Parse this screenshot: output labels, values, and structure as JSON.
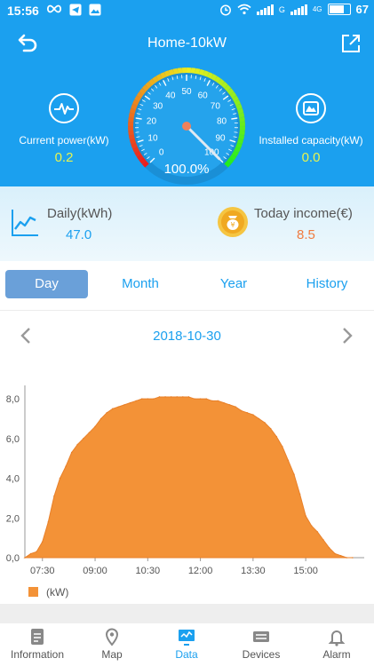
{
  "status": {
    "time": "15:56",
    "battery": "67",
    "sim": "G",
    "lte": "4G"
  },
  "header": {
    "title": "Home-10kW"
  },
  "current_power": {
    "label": "Current power(kW)",
    "value": "0.2"
  },
  "installed_capacity": {
    "label": "Installed capacity(kW)",
    "value": "0.0"
  },
  "gauge": {
    "percent_text": "100.0%",
    "ticks": [
      "0",
      "10",
      "20",
      "30",
      "40",
      "50",
      "60",
      "70",
      "80",
      "90",
      "100"
    ],
    "level": 1.0
  },
  "summary": {
    "daily_label": "Daily(kWh)",
    "daily_value": "47.0",
    "income_label": "Today income(€)",
    "income_value": "8.5"
  },
  "tabs": [
    "Day",
    "Month",
    "Year",
    "History"
  ],
  "active_tab": "Day",
  "date": "2018-10-30",
  "chart_data": {
    "type": "area",
    "x_ticks": [
      "07:30",
      "09:00",
      "10:30",
      "12:00",
      "13:30",
      "15:00"
    ],
    "y_ticks": [
      "0,0",
      "2,0",
      "4,0",
      "6,0",
      "8,0"
    ],
    "ylim": [
      0,
      8.5
    ],
    "xlim": [
      "07:00",
      "16:40"
    ],
    "legend": "(kW)",
    "x": [
      "07:00",
      "07:10",
      "07:20",
      "07:30",
      "07:40",
      "07:50",
      "08:00",
      "08:10",
      "08:20",
      "08:30",
      "08:40",
      "08:50",
      "09:00",
      "09:10",
      "09:20",
      "09:30",
      "09:40",
      "09:50",
      "10:00",
      "10:10",
      "10:20",
      "10:30",
      "10:40",
      "10:50",
      "11:00",
      "11:10",
      "11:20",
      "11:30",
      "11:40",
      "11:50",
      "12:00",
      "12:10",
      "12:20",
      "12:30",
      "12:40",
      "12:50",
      "13:00",
      "13:10",
      "13:20",
      "13:30",
      "13:40",
      "13:50",
      "14:00",
      "14:10",
      "14:20",
      "14:30",
      "14:40",
      "14:50",
      "15:00",
      "15:10",
      "15:20",
      "15:30",
      "15:40",
      "15:50",
      "16:00",
      "16:10",
      "16:20"
    ],
    "values": [
      0.0,
      0.2,
      0.3,
      0.8,
      1.8,
      3.1,
      4.0,
      4.6,
      5.3,
      5.7,
      6.0,
      6.3,
      6.6,
      7.0,
      7.3,
      7.5,
      7.6,
      7.7,
      7.8,
      7.9,
      8.0,
      8.0,
      8.0,
      8.1,
      8.1,
      8.1,
      8.1,
      8.1,
      8.1,
      8.0,
      8.0,
      8.0,
      7.9,
      7.9,
      7.8,
      7.7,
      7.6,
      7.4,
      7.3,
      7.2,
      7.0,
      6.8,
      6.5,
      6.1,
      5.6,
      4.9,
      4.2,
      3.2,
      2.1,
      1.6,
      1.3,
      0.9,
      0.5,
      0.2,
      0.1,
      0.0,
      0.0
    ],
    "color": "#f39237"
  },
  "nav": [
    {
      "label": "Information",
      "icon": "document-icon"
    },
    {
      "label": "Map",
      "icon": "map-pin-icon"
    },
    {
      "label": "Data",
      "icon": "monitor-icon"
    },
    {
      "label": "Devices",
      "icon": "device-icon"
    },
    {
      "label": "Alarm",
      "icon": "bell-icon"
    }
  ],
  "active_nav": "Data",
  "colors": {
    "primary": "#1ba0ef",
    "accent_yellow": "#e8f44f",
    "income": "#f07b3f",
    "daily": "#1ba0ef",
    "chart_fill": "#f39237"
  }
}
